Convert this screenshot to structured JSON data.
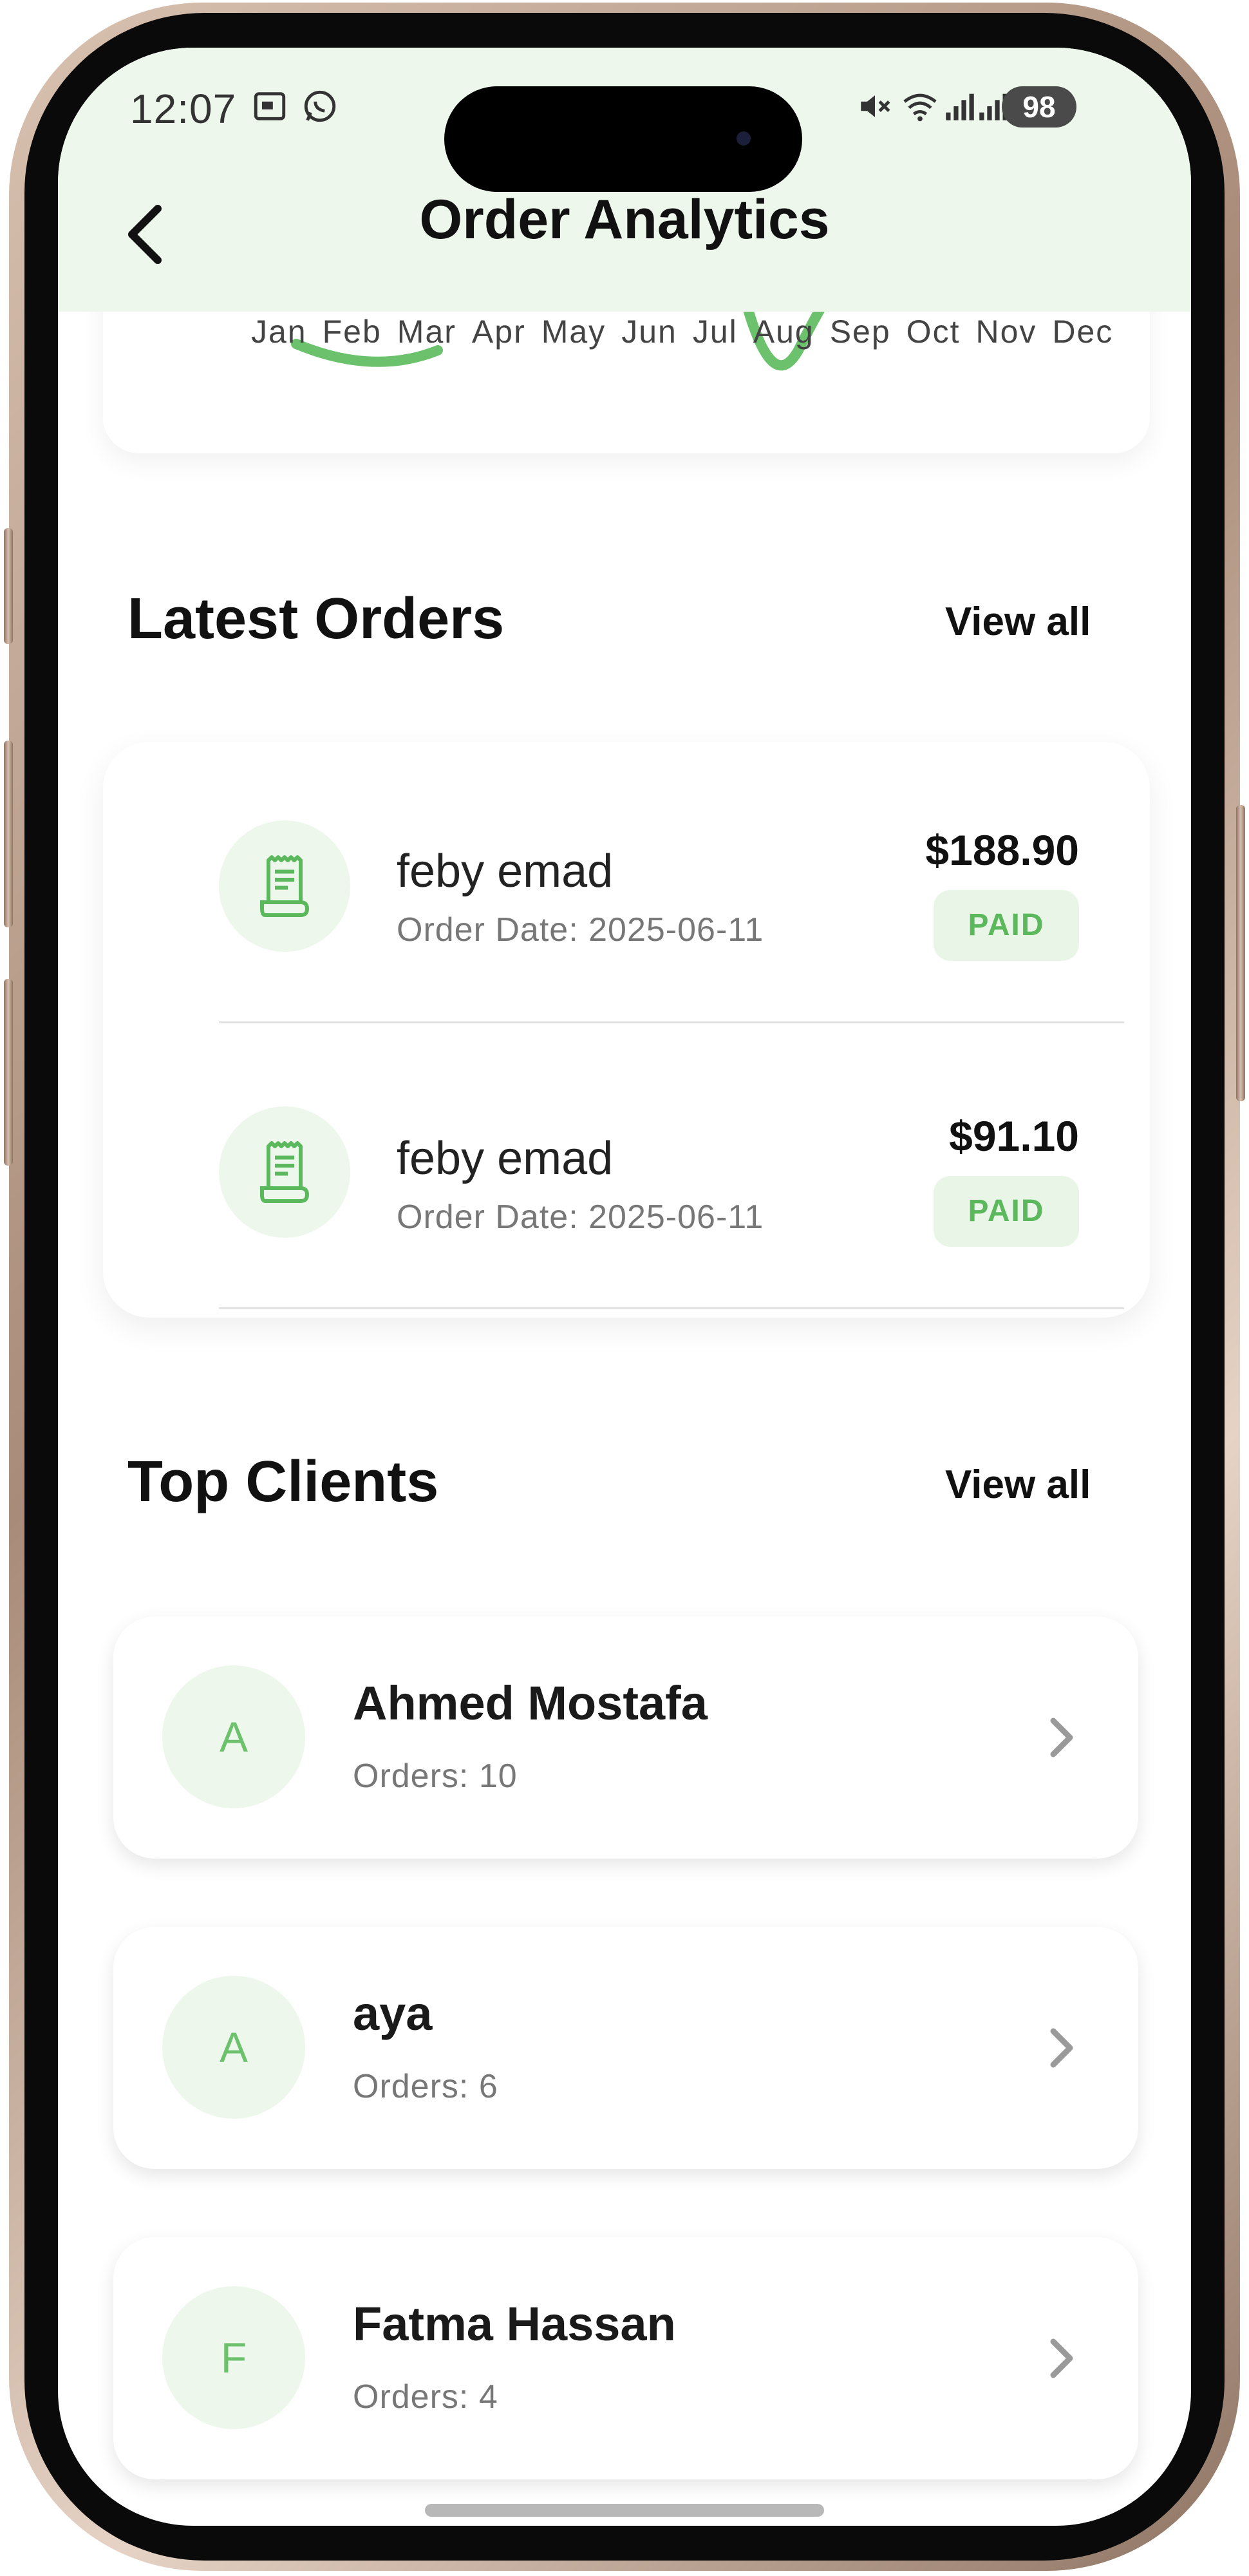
{
  "status_bar": {
    "time": "12:07",
    "battery": "98",
    "left_icons": [
      "screenshot-icon",
      "whatsapp-icon"
    ],
    "right_icons": [
      "mute-icon",
      "wifi-icon",
      "signal-icon",
      "signal-icon"
    ]
  },
  "header": {
    "title": "Order Analytics",
    "back_icon": "chevron-left-icon",
    "background": "#edf7ec"
  },
  "chart_remnant": {
    "months": [
      "Jan",
      "Feb",
      "Mar",
      "Apr",
      "May",
      "Jun",
      "Jul",
      "Aug",
      "Sep",
      "Oct",
      "Nov",
      "Dec"
    ],
    "line_color": "#6cc26c"
  },
  "latest_orders": {
    "title": "Latest Orders",
    "view_all": "View all",
    "items": [
      {
        "customer": "feby emad",
        "date": "Order Date: 2025-06-11",
        "amount": "$188.90",
        "status": "PAID",
        "icon": "receipt-icon"
      },
      {
        "customer": "feby emad",
        "date": "Order Date: 2025-06-11",
        "amount": "$91.10",
        "status": "PAID",
        "icon": "receipt-icon"
      }
    ]
  },
  "top_clients": {
    "title": "Top Clients",
    "view_all": "View all",
    "items": [
      {
        "initial": "A",
        "name": "Ahmed Mostafa",
        "orders": "Orders: 10"
      },
      {
        "initial": "A",
        "name": "aya",
        "orders": "Orders: 6"
      },
      {
        "initial": "F",
        "name": "Fatma Hassan",
        "orders": "Orders: 4"
      }
    ]
  },
  "colors": {
    "accent_green": "#6cc26c",
    "paid_text": "#5cb85c",
    "paid_bg": "#e9f6e7",
    "header_bg": "#edf7ec"
  }
}
